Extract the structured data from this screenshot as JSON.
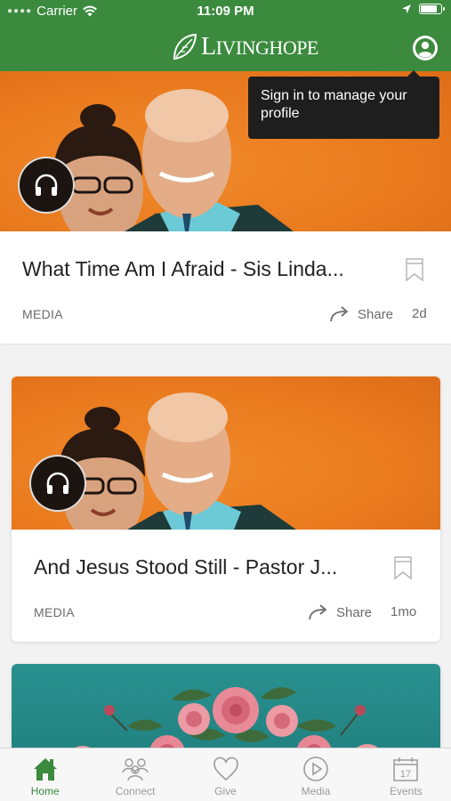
{
  "status_bar": {
    "carrier": "Carrier",
    "time": "11:09 PM",
    "battery_level": 0.85
  },
  "nav": {
    "logo_text": "IVINGHOPE",
    "logo_initial": "L"
  },
  "tooltip": {
    "text": "Sign in to manage your profile"
  },
  "feed": {
    "items": [
      {
        "title": "What Time Am I Afraid - Sis Linda...",
        "category": "MEDIA",
        "share_label": "Share",
        "age": "2d",
        "media_type": "audio"
      },
      {
        "title": "And Jesus Stood Still - Pastor J...",
        "category": "MEDIA",
        "share_label": "Share",
        "age": "1mo",
        "media_type": "audio"
      }
    ]
  },
  "tab_bar": {
    "tabs": [
      {
        "label": "Home",
        "icon": "home-icon",
        "active": true
      },
      {
        "label": "Connect",
        "icon": "people-icon",
        "active": false
      },
      {
        "label": "Give",
        "icon": "heart-icon",
        "active": false
      },
      {
        "label": "Media",
        "icon": "play-circle-icon",
        "active": false
      },
      {
        "label": "Events",
        "icon": "calendar-icon",
        "active": false
      }
    ]
  },
  "colors": {
    "brand_green": "#3b8a3e",
    "tooltip_bg": "#1e1e1e",
    "card_orange": "#ec7d22",
    "card_teal": "#26898a"
  }
}
